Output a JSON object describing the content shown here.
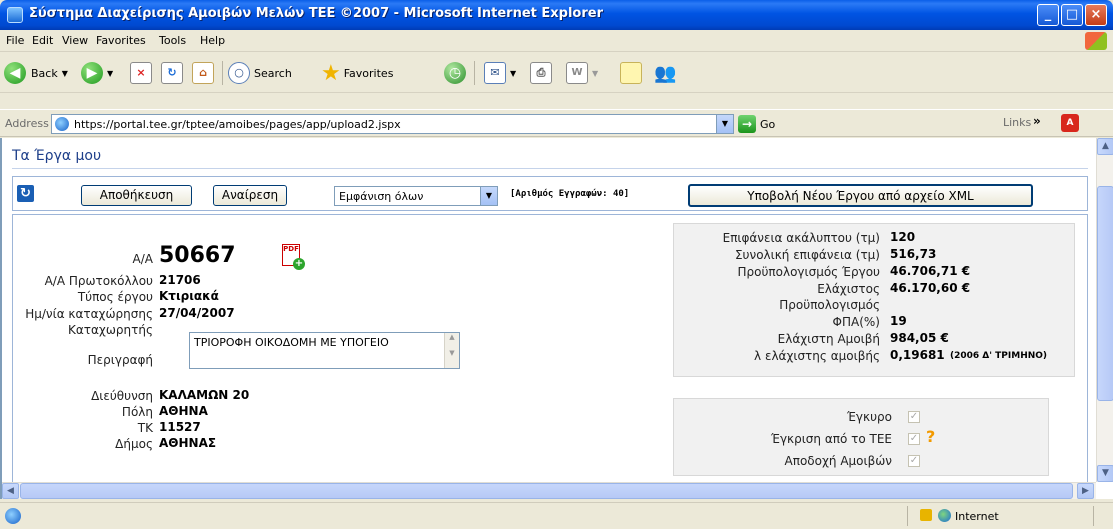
{
  "window": {
    "title": "Σύστημα Διαχείρισης Αμοιβών Μελών ΤΕΕ ©2007 - Microsoft Internet Explorer"
  },
  "menu": [
    "File",
    "Edit",
    "View",
    "Favorites",
    "Tools",
    "Help"
  ],
  "toolbar": {
    "back_label": "Back",
    "search_label": "Search",
    "favorites_label": "Favorites"
  },
  "address": {
    "label": "Address",
    "url": "https://portal.tee.gr/tptee/amoibes/pages/app/upload2.jspx",
    "go_label": "Go",
    "links_label": "Links"
  },
  "page": {
    "title": "Τα Έργα μου"
  },
  "actions": {
    "save_label": "Αποθήκευση",
    "search_label": "Αναίρεση",
    "filter_value": "Εμφάνιση όλων",
    "record_count": "[Αριθμός Εγγραφών: 40]",
    "upload_label": "Υποβολή Νέου Έργου από αρχείο XML"
  },
  "record": {
    "aa_label": "Α/Α",
    "aa_value": "50667",
    "protocol_label": "Α/Α Πρωτοκόλλου",
    "protocol_value": "21706",
    "type_label": "Τύπος έργου",
    "type_value": "Κτιριακά",
    "date_label": "Ημ/νία καταχώρησης",
    "date_value": "27/04/2007",
    "registrar_label": "Καταχωρητής",
    "description_label": "Περιγραφή",
    "description_value": "ΤΡΙΟΡΟΦΗ ΟΙΚΟΔΟΜΗ ΜΕ ΥΠΟΓΕΙΟ",
    "address_label": "Διεύθυνση",
    "address_value": "ΚΑΛΑΜΩΝ 20",
    "city_label": "Πόλη",
    "city_value": "ΑΘΗΝΑ",
    "tk_label": "ΤΚ",
    "tk_value": "11527",
    "municipality_label": "Δήμος",
    "municipality_value": "ΑΘΗΝΑΣ"
  },
  "figures": {
    "uncovered_area_label": "Επιφάνεια ακάλυπτου (τμ)",
    "uncovered_area_value": "120",
    "total_area_label": "Συνολική επιφάνεια (τμ)",
    "total_area_value": "516,73",
    "budget_label": "Προϋπολογισμός Έργου",
    "budget_value": "46.706,71 €",
    "min_budget_label_1": "Ελάχιστος",
    "min_budget_value": "46.170,60 €",
    "min_budget_label_2": "Προϋπολογισμός",
    "vat_label": "ΦΠΑ(%)",
    "vat_value": "19",
    "min_fee_label": "Ελάχιστη Αμοιβή",
    "min_fee_value": "984,05 €",
    "lambda_label": "λ ελάχιστης αμοιβής",
    "lambda_value": "0,19681",
    "lambda_period": "(2006 Δ' ΤΡΙΜΗΝΟ)"
  },
  "flags": {
    "valid_label": "Έγκυρο",
    "tee_approval_label": "Έγκριση από το ΤΕΕ",
    "fee_acceptance_label": "Αποδοχή Αμοιβών"
  },
  "status": {
    "zone": "Internet"
  }
}
